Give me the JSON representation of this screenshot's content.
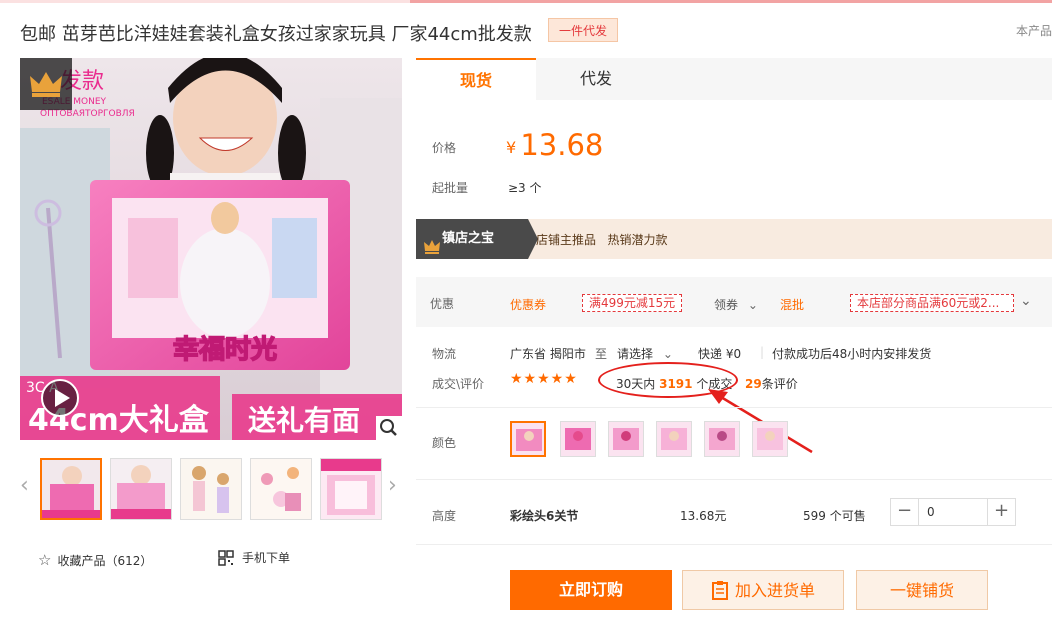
{
  "product": {
    "title": "包邮 茁芽芭比洋娃娃套装礼盒女孩过家家玩具 厂家44cm批发款",
    "tag": "一件代发",
    "corner_text": "本产品",
    "image_texts": {
      "banner_top": "发款",
      "banner_sub1": "ESALE MONEY",
      "banner_sub2": "ОПТОВАЯТОРГОВЛЯ",
      "box_title": "幸福时光",
      "bottom_left": "44cm大礼盒",
      "bottom_right": "送礼有面",
      "bottom_small": "3C  A"
    }
  },
  "gallery": {
    "prev": "‹",
    "next": "›"
  },
  "actions": {
    "favorite_label": "收藏产品（612）",
    "mobile_label": "手机下单"
  },
  "tabs": [
    {
      "label": "现货"
    },
    {
      "label": "代发"
    }
  ],
  "price": {
    "label": "价格",
    "currency": "¥",
    "value": "13.68",
    "moq_label": "起批量",
    "moq_value": "≥3 个"
  },
  "treasure": {
    "badge": "镇店之宝",
    "text": "店铺主推品   热销潜力款"
  },
  "promo": {
    "label": "优惠",
    "coupon_label": "优惠券",
    "coupon_value": "满499元减15元",
    "claim": "领券",
    "mix": "混批",
    "mix_value": "本店部分商品满60元或2..."
  },
  "logistics": {
    "label": "物流",
    "from": "广东省 揭阳市",
    "to": "至",
    "select": "请选择",
    "express": "快递 ¥0",
    "ship_note": "付款成功后48小时内安排发货"
  },
  "deals": {
    "label": "成交\\评价",
    "rating": 4.5,
    "stars": "★★★★★",
    "period": "30天内",
    "count": "3191",
    "unit": "个成交",
    "reviews": "29",
    "reviews_unit": "条评价"
  },
  "colors": {
    "label": "颜色"
  },
  "sku": {
    "label": "高度",
    "name": "彩绘头6关节",
    "price": "13.68元",
    "stock": "599 个可售",
    "minus": "−",
    "qty": "0",
    "plus": "+"
  },
  "buttons": {
    "buy": "立即订购",
    "cart": "加入进货单",
    "distribute": "一键铺货"
  },
  "colors_theme": {
    "accent": "#ff6a00",
    "annotation": "#e4201c"
  }
}
